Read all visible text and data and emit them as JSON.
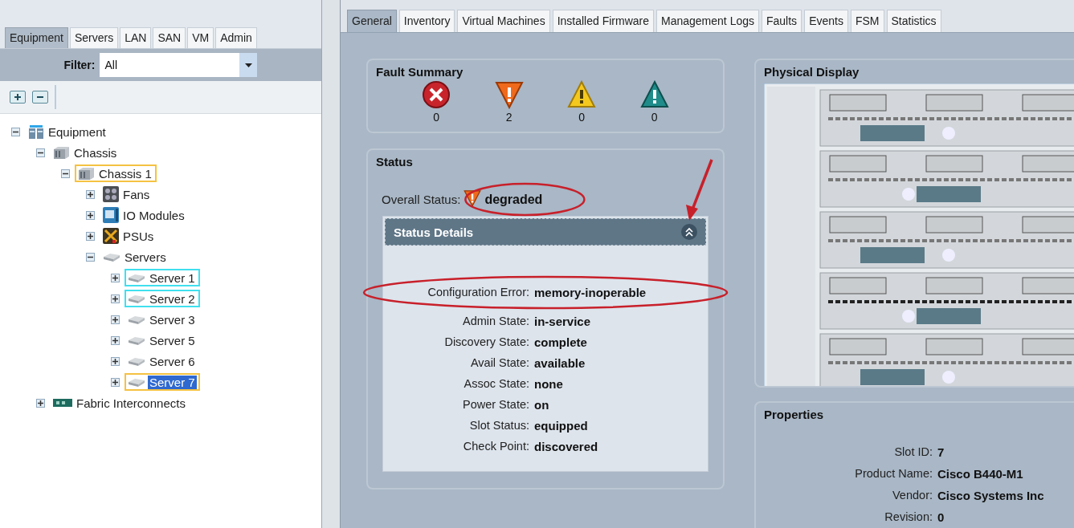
{
  "nav_tabs": [
    {
      "label": "Equipment",
      "selected": true
    },
    {
      "label": "Servers",
      "selected": false
    },
    {
      "label": "LAN",
      "selected": false
    },
    {
      "label": "SAN",
      "selected": false
    },
    {
      "label": "VM",
      "selected": false
    },
    {
      "label": "Admin",
      "selected": false
    }
  ],
  "filter": {
    "label": "Filter:",
    "value": "All"
  },
  "tree": [
    {
      "label": "Equipment",
      "kind": "equipment",
      "expanded": true,
      "selected": false,
      "children": [
        {
          "label": "Chassis",
          "kind": "chassis",
          "expanded": true,
          "selected": false,
          "children": [
            {
              "label": "Chassis 1",
              "kind": "chassis",
              "expanded": true,
              "selected": false,
              "color": "#f5c242",
              "children": [
                {
                  "label": "Fans",
                  "kind": "fans",
                  "expanded": false,
                  "selected": false
                },
                {
                  "label": "IO Modules",
                  "kind": "io",
                  "expanded": false,
                  "selected": false
                },
                {
                  "label": "PSUs",
                  "kind": "psu",
                  "expanded": false,
                  "selected": false
                },
                {
                  "label": "Servers",
                  "kind": "server",
                  "expanded": true,
                  "selected": false,
                  "children": [
                    {
                      "label": "Server 1",
                      "kind": "server",
                      "expanded": false,
                      "selected": false,
                      "color": "#3fe0ef"
                    },
                    {
                      "label": "Server 2",
                      "kind": "server",
                      "expanded": false,
                      "selected": false,
                      "color": "#3fe0ef"
                    },
                    {
                      "label": "Server 3",
                      "kind": "server",
                      "expanded": false,
                      "selected": false
                    },
                    {
                      "label": "Server 5",
                      "kind": "server",
                      "expanded": false,
                      "selected": false
                    },
                    {
                      "label": "Server 6",
                      "kind": "server",
                      "expanded": false,
                      "selected": false
                    },
                    {
                      "label": "Server 7",
                      "kind": "server",
                      "expanded": false,
                      "selected": true,
                      "color": "#f5c242"
                    }
                  ]
                }
              ]
            }
          ]
        },
        {
          "label": "Fabric Interconnects",
          "kind": "fabric",
          "expanded": false,
          "selected": false
        }
      ]
    }
  ],
  "content_tabs": [
    {
      "label": "General",
      "selected": true
    },
    {
      "label": "Inventory",
      "selected": false
    },
    {
      "label": "Virtual Machines",
      "selected": false
    },
    {
      "label": "Installed Firmware",
      "selected": false
    },
    {
      "label": "Management Logs",
      "selected": false
    },
    {
      "label": "Faults",
      "selected": false
    },
    {
      "label": "Events",
      "selected": false
    },
    {
      "label": "FSM",
      "selected": false
    },
    {
      "label": "Statistics",
      "selected": false
    }
  ],
  "fault_summary": {
    "title": "Fault Summary",
    "faults": [
      {
        "kind": "critical",
        "count": "0"
      },
      {
        "kind": "major",
        "count": "2"
      },
      {
        "kind": "minor",
        "count": "0"
      },
      {
        "kind": "warning",
        "count": "0"
      }
    ]
  },
  "status": {
    "title": "Status",
    "overall": {
      "label": "Overall Status:",
      "kind": "major",
      "value": "degraded"
    },
    "details": {
      "title": "Status Details",
      "expanded": true,
      "rows": [
        {
          "label": "Configuration Error:",
          "value": "memory-inoperable"
        },
        {
          "label": "Admin State:",
          "value": "in-service"
        },
        {
          "label": "Discovery State:",
          "value": "complete"
        },
        {
          "label": "Avail State:",
          "value": "available"
        },
        {
          "label": "Assoc State:",
          "value": "none"
        },
        {
          "label": "Power State:",
          "value": "on"
        },
        {
          "label": "Slot Status:",
          "value": "equipped"
        },
        {
          "label": "Check Point:",
          "value": "discovered"
        }
      ]
    }
  },
  "physical_display": {
    "title": "Physical Display"
  },
  "properties": {
    "title": "Properties",
    "rows": [
      {
        "label": "Slot ID:",
        "value": "7"
      },
      {
        "label": "Product Name:",
        "value": "Cisco B440-M1"
      },
      {
        "label": "Vendor:",
        "value": "Cisco Systems Inc"
      },
      {
        "label": "Revision:",
        "value": "0"
      }
    ]
  }
}
